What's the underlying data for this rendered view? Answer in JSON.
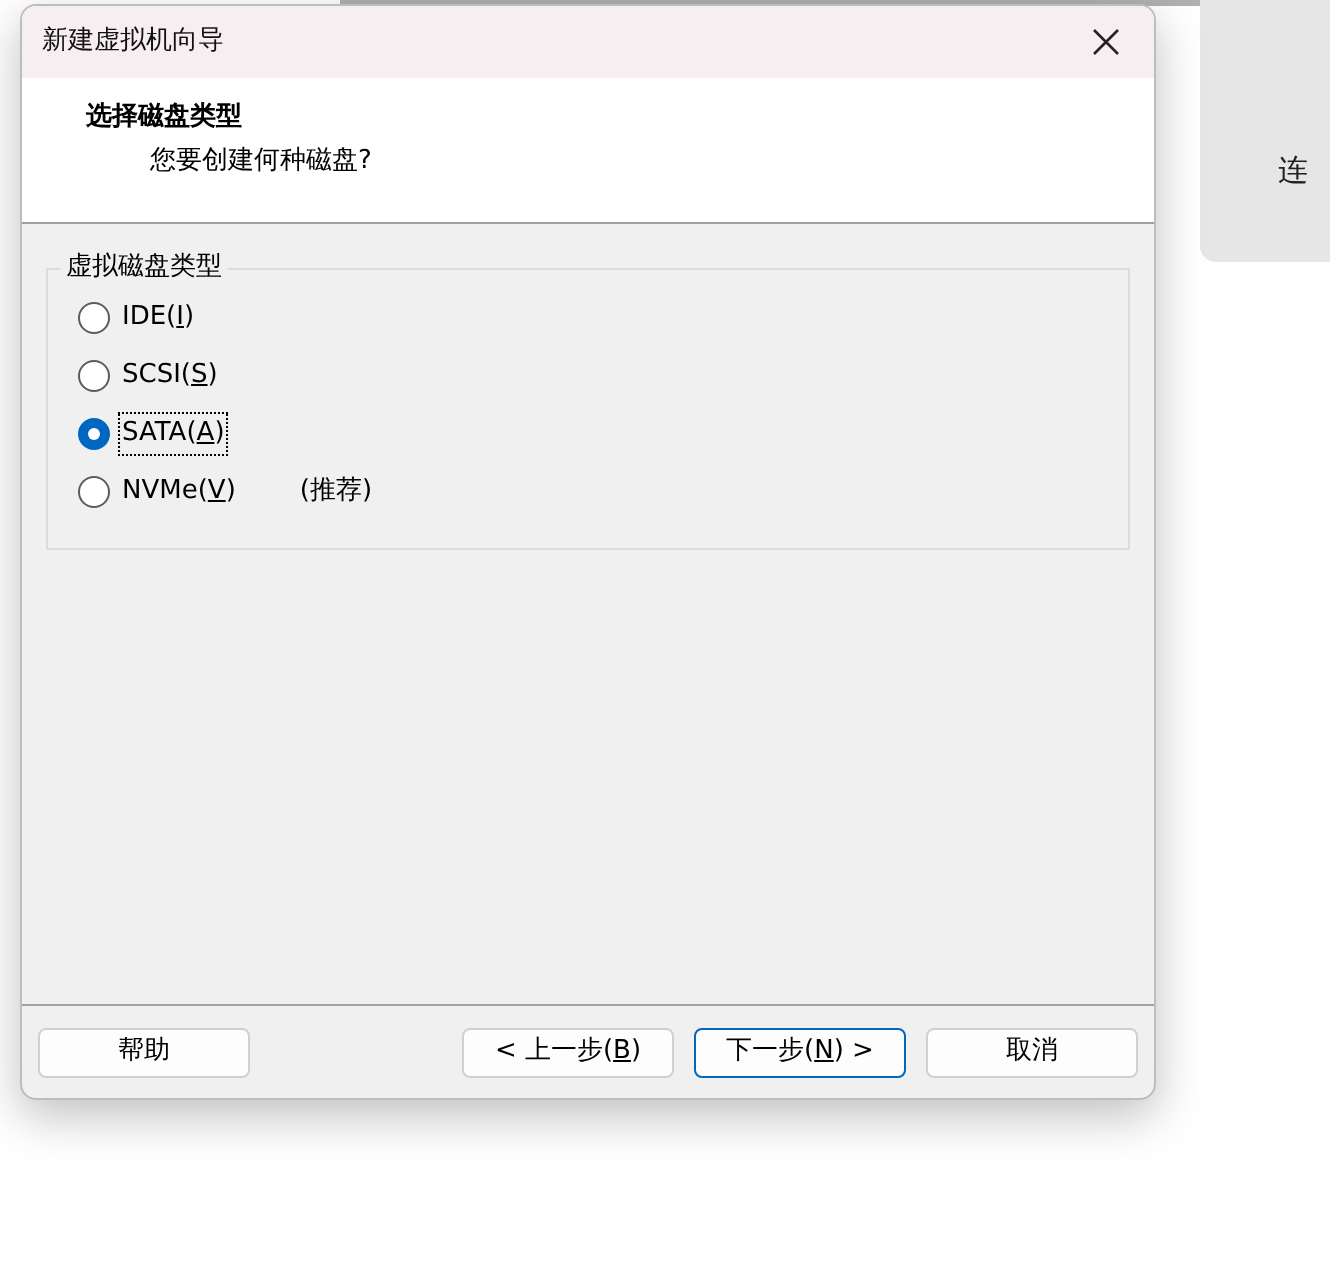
{
  "background_card": {
    "text": "连"
  },
  "window": {
    "title": "新建虚拟机向导"
  },
  "header": {
    "title": "选择磁盘类型",
    "subtitle": "您要创建何种磁盘?"
  },
  "group": {
    "title": "虚拟磁盘类型",
    "options": [
      {
        "before": "IDE(",
        "key": "I",
        "after": ")",
        "selected": false,
        "focused": false
      },
      {
        "before": "SCSI(",
        "key": "S",
        "after": ")",
        "selected": false,
        "focused": false
      },
      {
        "before": "SATA(",
        "key": "A",
        "after": ")",
        "selected": true,
        "focused": true
      },
      {
        "before": "NVMe(",
        "key": "V",
        "after": ")",
        "note": "(推荐)",
        "selected": false,
        "focused": false
      }
    ]
  },
  "buttons": [
    {
      "kind": "help",
      "before": "帮助",
      "selected": false
    },
    {
      "kind": "nav",
      "before": "< 上一步(",
      "key": "B",
      "after": ")",
      "selected": false
    },
    {
      "kind": "nav",
      "before": "下一步(",
      "key": "N",
      "after": ") >",
      "selected": true
    },
    {
      "kind": "cancel",
      "before": "取消",
      "selected": false
    }
  ]
}
